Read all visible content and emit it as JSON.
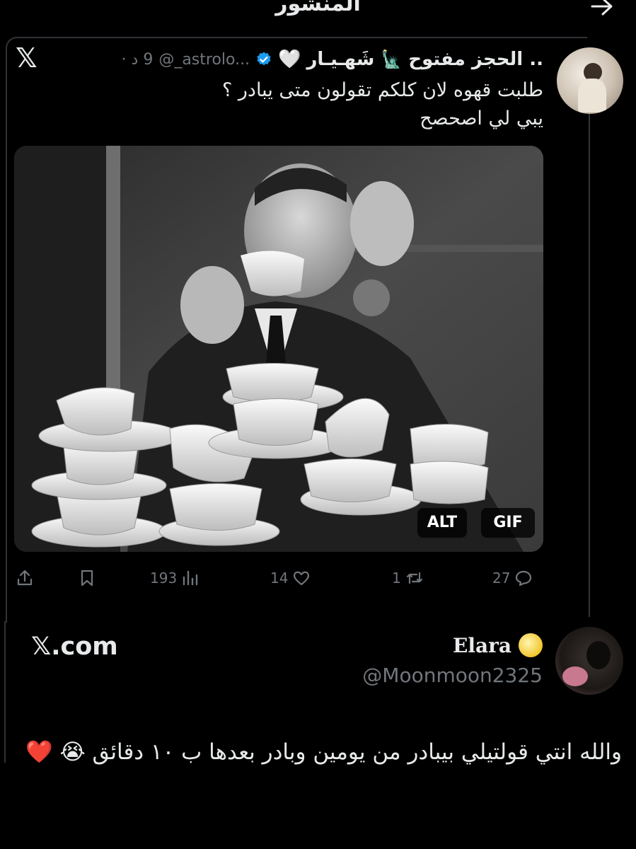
{
  "header": {
    "title": "المنشور",
    "back_icon": "arrow-right-icon"
  },
  "quoted_post": {
    "logo": "𝕏",
    "display_name": "شَهـيـار",
    "statue_emoji": "🗽",
    "name_rest": ".. الحجز مفتوح",
    "white_heart": "🤍",
    "handle": "@_astrolo...",
    "time": "9 د ·",
    "text_line1": "طلبت قهوه لان كلكم تقولون متى يبادر ؟",
    "text_line2": "يبي لي اصحصح",
    "media": {
      "alt_label": "ALT",
      "gif_label": "GIF"
    },
    "actions": {
      "views": "193",
      "likes": "14",
      "reposts": "1",
      "replies": "27"
    }
  },
  "reply": {
    "display_name": "Elara",
    "handle": "@Moonmoon2325",
    "site_label": "𝕏.com",
    "text": "والله انتي قولتيلي بيبادر من يومين وبادر بعدها ب ١٠ دقائق 😭 ❤️"
  },
  "colors": {
    "background": "#000000",
    "text": "#e7e9ea",
    "muted": "#71767b",
    "verified": "#1d9bf0",
    "divider": "#2f3336"
  }
}
